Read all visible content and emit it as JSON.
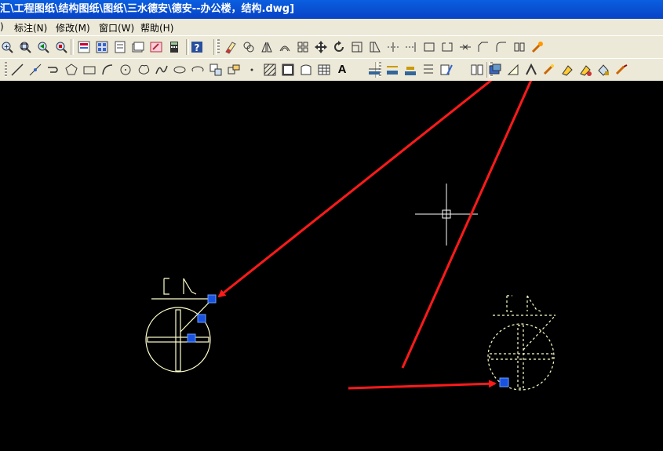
{
  "window": {
    "title": "汇\\工程图纸\\结构图纸\\图纸\\三水德安\\德安--办公楼，结构.dwg]"
  },
  "menubar": {
    "items": [
      {
        "label": ")"
      },
      {
        "label": "标注(N)"
      },
      {
        "label": "修改(M)"
      },
      {
        "label": "窗口(W)"
      },
      {
        "label": "帮助(H)"
      }
    ]
  },
  "toolbar_text": {
    "text_tool_label": "A"
  },
  "colors": {
    "canvas_bg": "#000000",
    "geometry": "#ffffcc",
    "grip": "#1a52e0",
    "annotation_arrow": "#ff1a1a",
    "crosshair": "#ffffff"
  },
  "icons": {
    "toolbar1": [
      "zoom-realtime-icon",
      "zoom-window-icon",
      "zoom-previous-icon",
      "zoom-extents-icon",
      "properties-icon",
      "design-center-icon",
      "tool-palettes-icon",
      "sheet-set-icon",
      "markup-icon",
      "calculator-icon",
      "help-icon",
      "erase-icon",
      "copy-icon",
      "mirror-icon",
      "offset-icon",
      "array-icon",
      "move-icon",
      "rotate-icon",
      "scale-icon",
      "stretch-icon",
      "trim-icon",
      "extend-icon",
      "break-at-point-icon",
      "break-icon",
      "join-icon",
      "chamfer-icon",
      "fillet-icon",
      "explode-icon",
      "match-properties-icon"
    ],
    "toolbar2": [
      "line-icon",
      "construction-line-icon",
      "polyline-icon",
      "polygon-icon",
      "rectangle-icon",
      "arc-icon",
      "circle-icon",
      "revision-cloud-icon",
      "spline-icon",
      "ellipse-icon",
      "ellipse-arc-icon",
      "insert-block-icon",
      "make-block-icon",
      "point-icon",
      "hatch-icon",
      "gradient-icon",
      "region-icon",
      "table-icon",
      "text-icon",
      "dim-linear-icon",
      "dim-aligned-icon",
      "dim-baseline-icon",
      "dim-continue-icon",
      "dim-leader-icon",
      "layer-icon",
      "layer-states-icon",
      "layer-prev-icon",
      "layer-tool-icon",
      "layer-isolate-icon",
      "layer-off-icon",
      "layer-freeze-icon",
      "layer-lock-icon",
      "layer-match-icon"
    ]
  }
}
